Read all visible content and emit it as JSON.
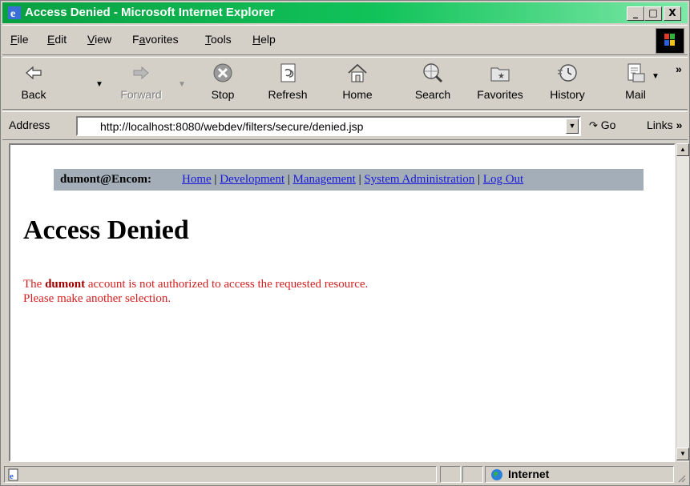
{
  "window": {
    "title": "Access Denied - Microsoft Internet Explorer",
    "controls": [
      "_",
      "□",
      "X"
    ]
  },
  "menu": [
    {
      "label": "File",
      "key": "F",
      "rest": "ile"
    },
    {
      "label": "Edit",
      "key": "E",
      "rest": "dit"
    },
    {
      "label": "View",
      "key": "V",
      "rest": "iew"
    },
    {
      "label": "Favorites",
      "pre": "F",
      "key": "a",
      "rest": "vorites"
    },
    {
      "label": "Tools",
      "key": "T",
      "rest": "ools"
    },
    {
      "label": "Help",
      "key": "H",
      "rest": "elp"
    }
  ],
  "toolbar": {
    "back": "Back",
    "forward": "Forward",
    "stop": "Stop",
    "refresh": "Refresh",
    "home": "Home",
    "search": "Search",
    "favorites": "Favorites",
    "history": "History",
    "mail": "Mail",
    "overflow": "»"
  },
  "address": {
    "label": "Address",
    "url": "http://localhost:8080/webdev/filters/secure/denied.jsp",
    "go": "Go",
    "links": "Links",
    "links_overflow": "»"
  },
  "page": {
    "user": "dumont@Encom:",
    "nav_links": [
      "Home",
      "Development",
      "Management",
      "System Administration",
      "Log Out"
    ],
    "separator": "|",
    "heading": "Access Denied",
    "message_prefix": "The ",
    "message_account": "dumont",
    "message_suffix": " account is not authorized to access the requested resource.",
    "message_line2": "Please make another selection."
  },
  "status": {
    "zone": "Internet"
  },
  "colors": {
    "titlebar": "#0a9e3c",
    "navbar": "#a3aeb8",
    "link": "#1a1ad8",
    "error_text": "#d42020"
  }
}
